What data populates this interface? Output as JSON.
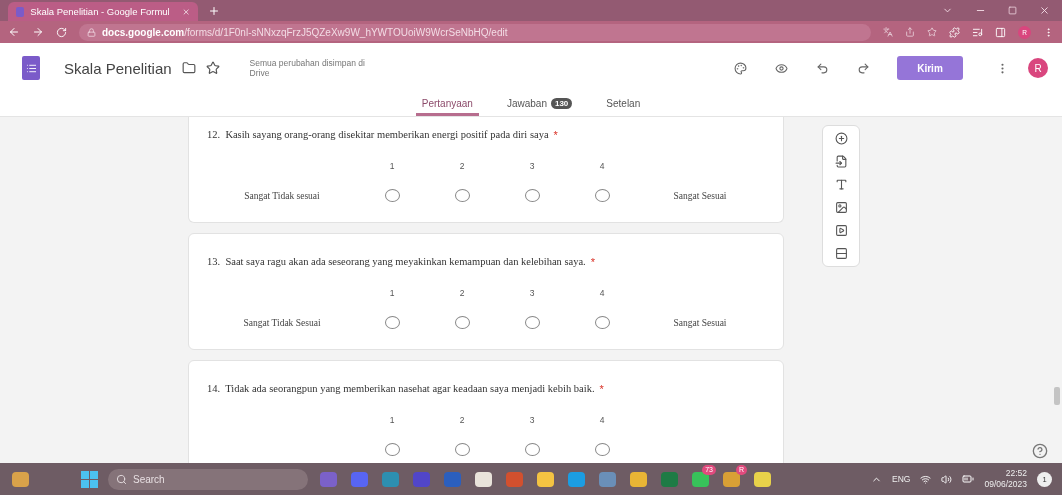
{
  "browser": {
    "tab_title": "Skala Penelitian - Google Formul",
    "url_host": "docs.google.com",
    "url_path": "/forms/d/1F0nl-sNNxzqFrzJ5QZeXw9W_hYWTOUoiW9WcrSeNbHQ/edit",
    "profile": "R"
  },
  "header": {
    "title": "Skala Penelitian",
    "save_status": "Semua perubahan disimpan di Drive",
    "send_button": "Kirim",
    "avatar": "R"
  },
  "tabs": [
    {
      "label": "Pertanyaan",
      "selected": true
    },
    {
      "label": "Jawaban",
      "count": "130",
      "selected": false
    },
    {
      "label": "Setelan",
      "selected": false
    }
  ],
  "questions": [
    {
      "number": "12.",
      "text": "Kasih sayang orang-orang disekitar memberikan energi positif pada diri saya",
      "required_mark": "*",
      "low_label": "Sangat Tidak sesuai",
      "high_label": "Sangat Sesuai",
      "options": [
        {
          "label": "1",
          "selected": false
        },
        {
          "label": "2",
          "selected": false
        },
        {
          "label": "3",
          "selected": false
        },
        {
          "label": "4",
          "selected": false
        }
      ]
    },
    {
      "number": "13.",
      "text": "Saat saya ragu akan ada seseorang yang meyakinkan kemampuan dan kelebihan saya.",
      "required_mark": "*",
      "low_label": "Sangat Tidak Sesuai",
      "high_label": "Sangat Sesuai",
      "options": [
        {
          "label": "1",
          "selected": false
        },
        {
          "label": "2",
          "selected": false
        },
        {
          "label": "3",
          "selected": false
        },
        {
          "label": "4",
          "selected": false
        }
      ]
    },
    {
      "number": "14.",
      "text": "Tidak ada seorangpun yang memberikan nasehat agar keadaan saya menjadi kebih baik.",
      "required_mark": "*",
      "options": [
        {
          "label": "1",
          "selected": false
        },
        {
          "label": "2",
          "selected": false
        },
        {
          "label": "3",
          "selected": false
        },
        {
          "label": "4",
          "selected": false
        }
      ]
    }
  ],
  "taskbar": {
    "search_placeholder": "Search",
    "apps": [
      {
        "kind": "meet"
      },
      {
        "kind": "discord"
      },
      {
        "kind": "tiles"
      },
      {
        "kind": "stylus"
      },
      {
        "kind": "word"
      },
      {
        "kind": "store"
      },
      {
        "kind": "powerpoint"
      },
      {
        "kind": "folder"
      },
      {
        "kind": "edge"
      },
      {
        "kind": "globe"
      },
      {
        "kind": "chrome"
      },
      {
        "kind": "excel"
      },
      {
        "kind": "whatsapp",
        "badge": "73"
      },
      {
        "kind": "chrome-active",
        "badge": "R"
      },
      {
        "kind": "cloud-folder"
      }
    ],
    "language": "ENG",
    "time": "22:52",
    "date": "09/06/2023",
    "notifications": "1"
  }
}
